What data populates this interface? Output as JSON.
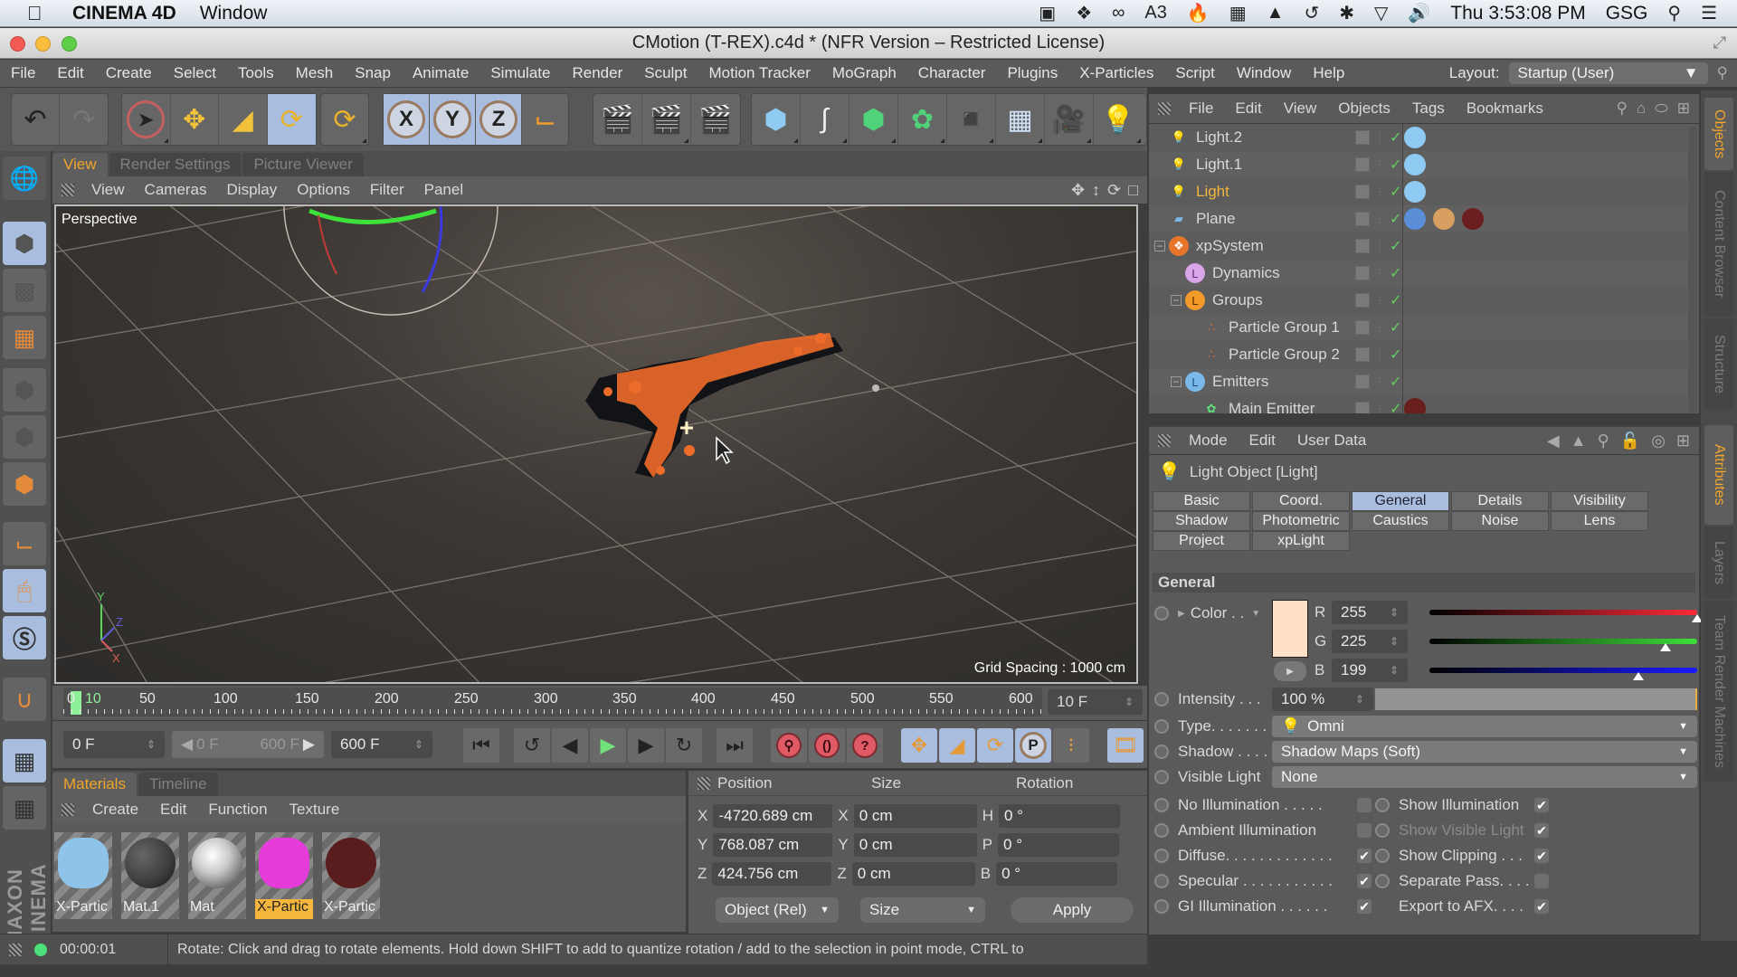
{
  "macbar": {
    "app_name": "CINEMA 4D",
    "menu": "Window",
    "status_icons": [
      "video-camera-icon",
      "dropbox-icon",
      "creative-cloud-icon",
      "adobe-icon",
      "flame-icon",
      "server-icon",
      "airplay-icon",
      "time-machine-icon",
      "bluetooth-icon",
      "wifi-icon",
      "volume-icon"
    ],
    "adobe_badge": "3",
    "clock": "Thu 3:53:08 PM",
    "user": "GSG"
  },
  "window": {
    "title": "CMotion (T-REX).c4d * (NFR Version – Restricted License)"
  },
  "app_menu": {
    "items": [
      "File",
      "Edit",
      "Create",
      "Select",
      "Tools",
      "Mesh",
      "Snap",
      "Animate",
      "Simulate",
      "Render",
      "Sculpt",
      "Motion Tracker",
      "MoGraph",
      "Character",
      "Plugins",
      "X-Particles",
      "Script",
      "Window",
      "Help"
    ],
    "layout_label": "Layout:",
    "layout_value": "Startup (User)"
  },
  "toolbar": {
    "axis_x": "X",
    "axis_y": "Y",
    "axis_z": "Z"
  },
  "viewport": {
    "tabs": [
      "View",
      "Render Settings",
      "Picture Viewer"
    ],
    "active_tab": "View",
    "menu": [
      "View",
      "Cameras",
      "Display",
      "Options",
      "Filter",
      "Panel"
    ],
    "camera_label": "Perspective",
    "grid_spacing": "Grid Spacing : 1000 cm",
    "axis_labels": {
      "x": "X",
      "y": "Y",
      "z": "Z"
    }
  },
  "timeline": {
    "ticks": [
      "0",
      "10",
      "50",
      "100",
      "150",
      "200",
      "250",
      "300",
      "350",
      "400",
      "450",
      "500",
      "550",
      "600"
    ],
    "current_frame": "10 F",
    "start_field": "0 F",
    "range_start": "0 F",
    "range_end": "600 F",
    "end_field": "600 F"
  },
  "materials": {
    "tabs": [
      "Materials",
      "Timeline"
    ],
    "active_tab": "Materials",
    "menu": [
      "Create",
      "Edit",
      "Function",
      "Texture"
    ],
    "items": [
      {
        "label": "X-Partic",
        "color": "#8fc4ea",
        "selected": false
      },
      {
        "label": "Mat.1",
        "color": "#3c3c3c",
        "selected": false
      },
      {
        "label": "Mat",
        "color": "#c8c8c8",
        "selected": false
      },
      {
        "label": "X-Partic",
        "color": "#e43bd9",
        "selected": true
      },
      {
        "label": "X-Partic",
        "color": "#5a1d1d",
        "selected": false
      }
    ]
  },
  "coordinates": {
    "headers": [
      "Position",
      "Size",
      "Rotation"
    ],
    "rows": [
      {
        "pos_axis": "X",
        "pos": "-4720.689 cm",
        "size_axis": "X",
        "size": "0 cm",
        "rot_axis": "H",
        "rot": "0 °"
      },
      {
        "pos_axis": "Y",
        "pos": "768.087 cm",
        "size_axis": "Y",
        "size": "0 cm",
        "rot_axis": "P",
        "rot": "0 °"
      },
      {
        "pos_axis": "Z",
        "pos": "424.756 cm",
        "size_axis": "Z",
        "size": "0 cm",
        "rot_axis": "B",
        "rot": "0 °"
      }
    ],
    "mode": "Object (Rel)",
    "size_mode": "Size",
    "apply": "Apply"
  },
  "status": {
    "time": "00:00:01",
    "text": "Rotate: Click and drag to rotate elements. Hold down SHIFT to add to quantize rotation / add to the selection in point mode, CTRL to"
  },
  "object_manager": {
    "menu": [
      "File",
      "Edit",
      "View",
      "Objects",
      "Tags",
      "Bookmarks"
    ],
    "objects": [
      {
        "name": "Light.2",
        "depth": 0,
        "icon": "light-icon",
        "active": false,
        "tags": [
          "light-tag"
        ]
      },
      {
        "name": "Light.1",
        "depth": 0,
        "icon": "light-icon",
        "active": false,
        "tags": [
          "light-tag"
        ]
      },
      {
        "name": "Light",
        "depth": 0,
        "icon": "light-icon",
        "active": true,
        "tags": [
          "light-tag"
        ]
      },
      {
        "name": "Plane",
        "depth": 0,
        "icon": "plane-icon",
        "active": false,
        "tags": [
          "xp-collider-tag",
          "texture-tag",
          "material-tag"
        ]
      },
      {
        "name": "xpSystem",
        "depth": 0,
        "icon": "xpsystem-icon",
        "active": false,
        "tags": []
      },
      {
        "name": "Dynamics",
        "depth": 1,
        "icon": "dynamics-icon",
        "active": false,
        "tags": []
      },
      {
        "name": "Groups",
        "depth": 1,
        "icon": "groups-icon",
        "active": false,
        "tags": []
      },
      {
        "name": "Particle Group 1",
        "depth": 2,
        "icon": "particle-group-icon",
        "active": false,
        "tags": []
      },
      {
        "name": "Particle Group 2",
        "depth": 2,
        "icon": "particle-group-icon",
        "active": false,
        "tags": []
      },
      {
        "name": "Emitters",
        "depth": 1,
        "icon": "emitters-icon",
        "active": false,
        "tags": []
      },
      {
        "name": "Main Emitter",
        "depth": 2,
        "icon": "emitter-icon",
        "active": false,
        "tags": [
          "material-tag"
        ]
      }
    ]
  },
  "attribute_manager": {
    "menu": [
      "Mode",
      "Edit",
      "User Data"
    ],
    "title": "Light Object [Light]",
    "tabs": [
      "Basic",
      "Coord.",
      "General",
      "Details",
      "Visibility",
      "Shadow",
      "Photometric",
      "Caustics",
      "Noise",
      "Lens",
      "Project",
      "xpLight"
    ],
    "active_tab": "General",
    "section": "General",
    "color_label": "Color . .",
    "color_hex": "#FFE1C7",
    "r_label": "R",
    "r": "255",
    "r_fraction": 1.0,
    "g_label": "G",
    "g": "225",
    "g_fraction": 0.882,
    "b_label": "B",
    "b": "199",
    "b_fraction": 0.78,
    "intensity_label": "Intensity . . .",
    "intensity": "100 %",
    "intensity_fraction": 1.0,
    "type_label": "Type. . . . . . .",
    "type": "Omni",
    "shadow_label": "Shadow . . . .",
    "shadow": "Shadow Maps (Soft)",
    "visible_light_label": "Visible Light",
    "visible_light": "None",
    "checkboxes_left": [
      {
        "label": "No Illumination . . . . .",
        "checked": false
      },
      {
        "label": "Ambient Illumination",
        "checked": false
      },
      {
        "label": "Diffuse. . . . . . . . . . . . .",
        "checked": true
      },
      {
        "label": "Specular . . . . . . . . . . .",
        "checked": true
      },
      {
        "label": "GI Illumination . . . . . .",
        "checked": true
      }
    ],
    "checkboxes_right": [
      {
        "label": "Show Illumination",
        "checked": true,
        "disabled": false,
        "radio": true
      },
      {
        "label": "Show Visible Light",
        "checked": true,
        "disabled": true,
        "radio": true
      },
      {
        "label": "Show Clipping . . .",
        "checked": true,
        "disabled": false,
        "radio": true
      },
      {
        "label": "Separate Pass. . . .",
        "checked": false,
        "disabled": false,
        "radio": true
      },
      {
        "label": "Export to AFX. . . .",
        "checked": true,
        "disabled": false,
        "radio": false
      }
    ]
  },
  "side_tabs": {
    "top": [
      "Objects",
      "Content Browser",
      "Structure"
    ],
    "bottom": [
      "Attributes",
      "Layers",
      "Team Render Machines"
    ]
  }
}
